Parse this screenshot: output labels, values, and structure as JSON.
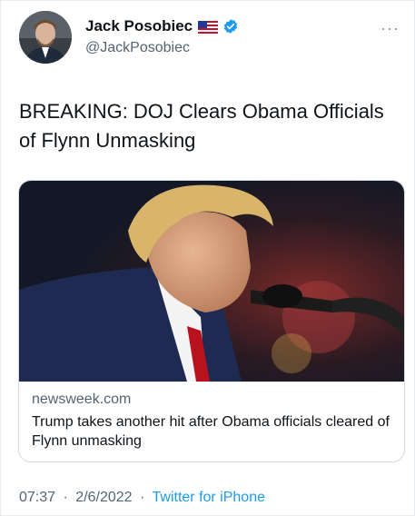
{
  "author": {
    "name": "Jack Posobiec",
    "handle": "@JackPosobiec",
    "flag_icon": "us-flag-icon",
    "verified_icon": "verified-badge-icon"
  },
  "more_menu": {
    "label": "···"
  },
  "tweet": {
    "text": "BREAKING: DOJ Clears Obama Officials of Flynn Unmasking"
  },
  "link_card": {
    "domain": "newsweek.com",
    "title": "Trump takes another hit after Obama officials cleared of Flynn unmasking",
    "image_description_icon": "photo-of-man-speaking-at-microphone"
  },
  "meta": {
    "time": "07:37",
    "date": "2/6/2022",
    "separator": "·",
    "source": "Twitter for iPhone"
  },
  "colors": {
    "accent": "#1d9bf0",
    "secondary_text": "#536471",
    "primary_text": "#0f1419"
  }
}
